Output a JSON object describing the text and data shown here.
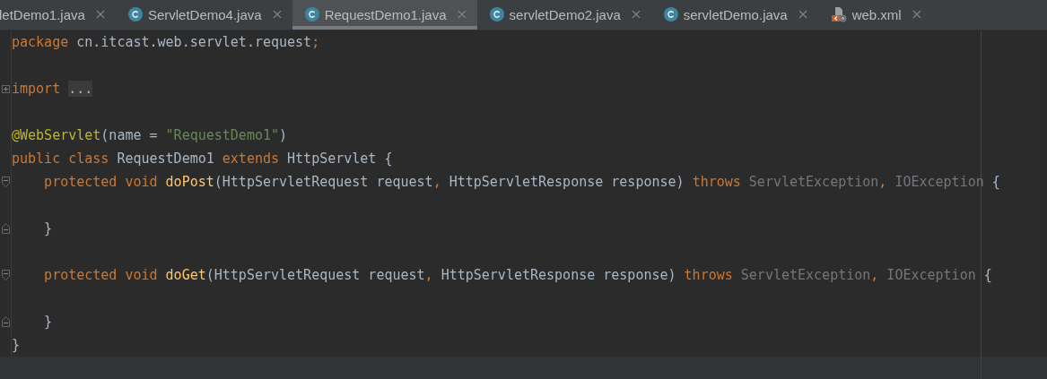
{
  "tabs": [
    {
      "label": "letDemo1.java",
      "selected": false
    },
    {
      "label": "ServletDemo4.java",
      "kind": "class",
      "selected": false
    },
    {
      "label": "RequestDemo1.java",
      "kind": "class",
      "selected": true
    },
    {
      "label": "servletDemo2.java",
      "kind": "class",
      "selected": false
    },
    {
      "label": "servletDemo.java",
      "kind": "class",
      "selected": false
    },
    {
      "label": "web.xml",
      "kind": "xml",
      "selected": false
    }
  ],
  "code_lines": [
    {
      "kind": "code",
      "tokens": [
        {
          "text": "package",
          "kind": "keyword"
        },
        {
          "text": " cn.itcast.web.servlet.request",
          "kind": "plain"
        },
        {
          "text": ";",
          "kind": "keyword"
        }
      ]
    },
    {
      "kind": "blank"
    },
    {
      "kind": "code",
      "collapsed": true,
      "tokens": [
        {
          "text": "import ",
          "kind": "keyword"
        },
        {
          "text": "...",
          "kind": "folded"
        }
      ]
    },
    {
      "kind": "blank"
    },
    {
      "kind": "code",
      "tokens": [
        {
          "text": "@WebServlet",
          "kind": "annotation"
        },
        {
          "text": "(name = ",
          "kind": "plain"
        },
        {
          "text": "\"RequestDemo1\"",
          "kind": "string"
        },
        {
          "text": ")",
          "kind": "plain"
        }
      ]
    },
    {
      "kind": "code",
      "tokens": [
        {
          "text": "public class",
          "kind": "keyword"
        },
        {
          "text": " RequestDemo1 ",
          "kind": "plain"
        },
        {
          "text": "extends",
          "kind": "keyword"
        },
        {
          "text": " HttpServlet {",
          "kind": "plain"
        }
      ]
    },
    {
      "kind": "code",
      "fold_start": true,
      "tokens": [
        {
          "text": "    protected void ",
          "kind": "keyword"
        },
        {
          "text": "doPost",
          "kind": "method"
        },
        {
          "text": "(HttpServletRequest request",
          "kind": "plain"
        },
        {
          "text": ",",
          "kind": "keyword"
        },
        {
          "text": " HttpServletResponse response) ",
          "kind": "plain"
        },
        {
          "text": "throws",
          "kind": "keyword"
        },
        {
          "text": " ServletException",
          "kind": "unused"
        },
        {
          "text": ",",
          "kind": "keyword"
        },
        {
          "text": " IOException",
          "kind": "unused"
        },
        {
          "text": " {",
          "kind": "plain"
        }
      ]
    },
    {
      "kind": "blank"
    },
    {
      "kind": "code",
      "fold_end": true,
      "tokens": [
        {
          "text": "    }",
          "kind": "plain"
        }
      ]
    },
    {
      "kind": "blank"
    },
    {
      "kind": "code",
      "fold_start": true,
      "tokens": [
        {
          "text": "    protected void ",
          "kind": "keyword"
        },
        {
          "text": "doGet",
          "kind": "method"
        },
        {
          "text": "(HttpServletRequest request",
          "kind": "plain"
        },
        {
          "text": ",",
          "kind": "keyword"
        },
        {
          "text": " HttpServletResponse response) ",
          "kind": "plain"
        },
        {
          "text": "throws",
          "kind": "keyword"
        },
        {
          "text": " ServletException",
          "kind": "unused"
        },
        {
          "text": ",",
          "kind": "keyword"
        },
        {
          "text": " IOException",
          "kind": "unused"
        },
        {
          "text": " {",
          "kind": "plain"
        }
      ]
    },
    {
      "kind": "blank"
    },
    {
      "kind": "code",
      "fold_end": true,
      "tokens": [
        {
          "text": "    }",
          "kind": "plain"
        }
      ]
    },
    {
      "kind": "code",
      "tokens": [
        {
          "text": "}",
          "kind": "plain"
        }
      ]
    }
  ]
}
